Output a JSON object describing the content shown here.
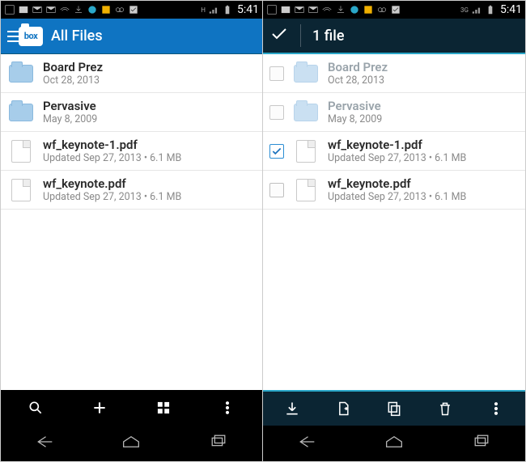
{
  "statusbar": {
    "time": "5:41",
    "signal_label_left": "H",
    "signal_label_right": "3G"
  },
  "left": {
    "title": "All Files",
    "items": [
      {
        "name": "Board Prez",
        "sub": "Oct 28, 2013",
        "type": "folder"
      },
      {
        "name": "Pervasive",
        "sub": "May 8, 2009",
        "type": "folder"
      },
      {
        "name": "wf_keynote-1.pdf",
        "sub": "Updated Sep 27, 2013  •  6.1 MB",
        "type": "file"
      },
      {
        "name": "wf_keynote.pdf",
        "sub": "Updated Sep 27, 2013  •  6.1 MB",
        "type": "file"
      }
    ],
    "actions": [
      "search",
      "add",
      "grid",
      "overflow"
    ]
  },
  "right": {
    "title": "1 file",
    "items": [
      {
        "name": "Board Prez",
        "sub": "Oct 28, 2013",
        "type": "folder",
        "checked": false
      },
      {
        "name": "Pervasive",
        "sub": "May 8, 2009",
        "type": "folder",
        "checked": false
      },
      {
        "name": "wf_keynote-1.pdf",
        "sub": "Updated Sep 27, 2013  •  6.1 MB",
        "type": "file",
        "checked": true
      },
      {
        "name": "wf_keynote.pdf",
        "sub": "Updated Sep 27, 2013  •  6.1 MB",
        "type": "file",
        "checked": false
      }
    ],
    "actions": [
      "download",
      "share",
      "copy",
      "delete",
      "overflow"
    ]
  }
}
